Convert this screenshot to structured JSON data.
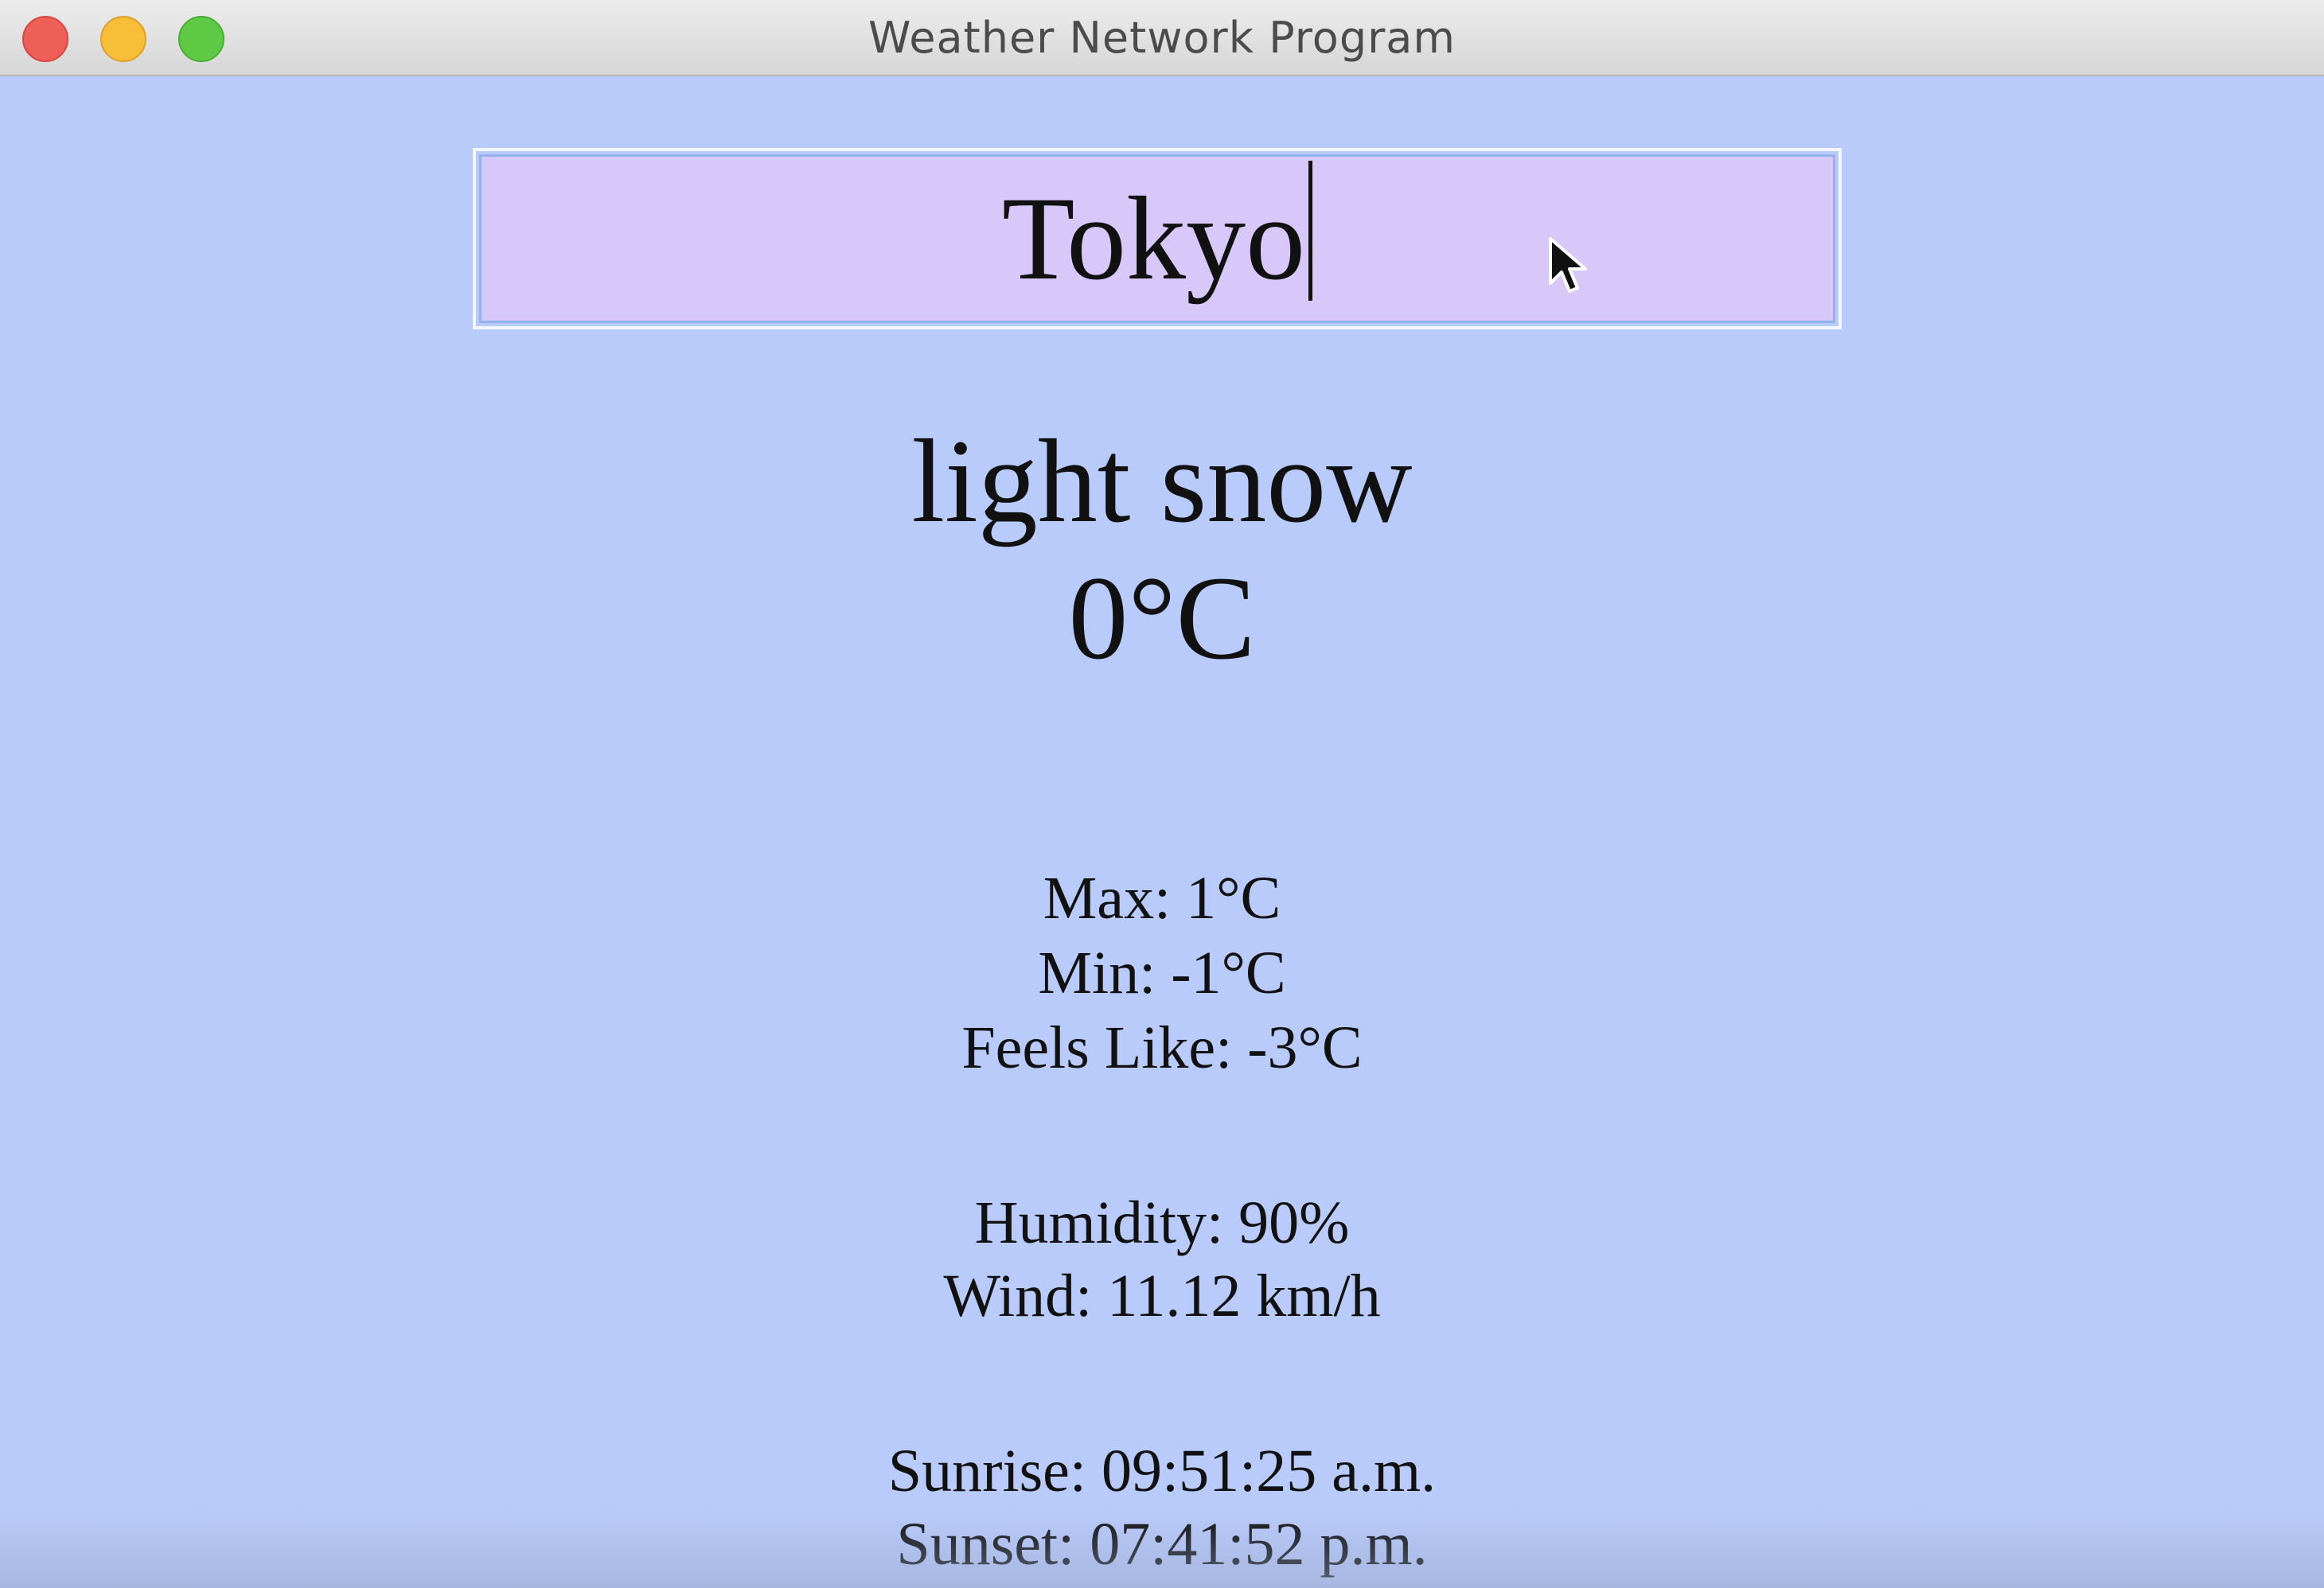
{
  "window": {
    "title": "Weather Network Program",
    "background_color": "#b9cbfb"
  },
  "search": {
    "value": "Tokyo",
    "field_color": "#d7c8f9"
  },
  "weather": {
    "description": "light snow",
    "temperature": "0°C",
    "max": "Max: 1°C",
    "min": "Min: -1°C",
    "feels_like": "Feels Like: -3°C",
    "humidity": "Humidity: 90%",
    "wind": "Wind: 11.12 km/h",
    "sunrise": "Sunrise: 09:51:25 a.m.",
    "sunset": "Sunset: 07:41:52 p.m."
  },
  "icons": {
    "close": "close-icon",
    "minimize": "minimize-icon",
    "maximize": "maximize-icon",
    "cursor": "mouse-pointer-icon"
  }
}
